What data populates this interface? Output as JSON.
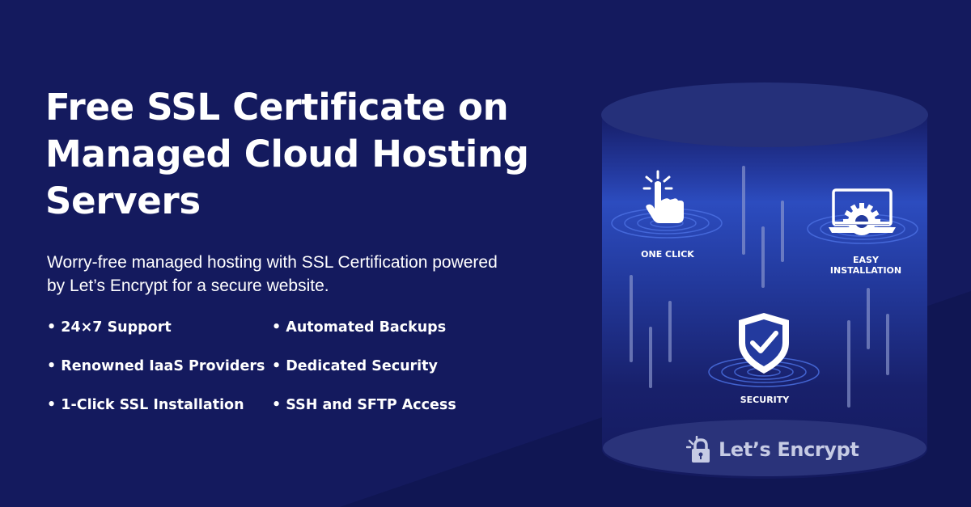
{
  "headline": "Free SSL Certificate on Managed Cloud Hosting Servers",
  "subtitle": "Worry-free managed hosting with SSL Certification powered by Let’s Encrypt for a secure website.",
  "features": [
    "24×7 Support",
    "Automated Backups",
    "Renowned IaaS Providers",
    "Dedicated Security",
    "1-Click SSL Installation",
    "SSH and SFTP Access"
  ],
  "illustration": {
    "one_click_label": "ONE CLICK",
    "easy_installation_label_line1": "EASY",
    "easy_installation_label_line2": "INSTALLATION",
    "security_label": "SECURITY",
    "icons": [
      "cursor-click-icon",
      "laptop-gear-icon",
      "shield-check-icon",
      "padlock-icon"
    ]
  },
  "brand": {
    "name": "Let’s Encrypt"
  },
  "colors": {
    "background": "#141a5e",
    "cylinder_glow": "#2b47b8",
    "text": "#ffffff",
    "brand_text": "#c6cbe4"
  }
}
